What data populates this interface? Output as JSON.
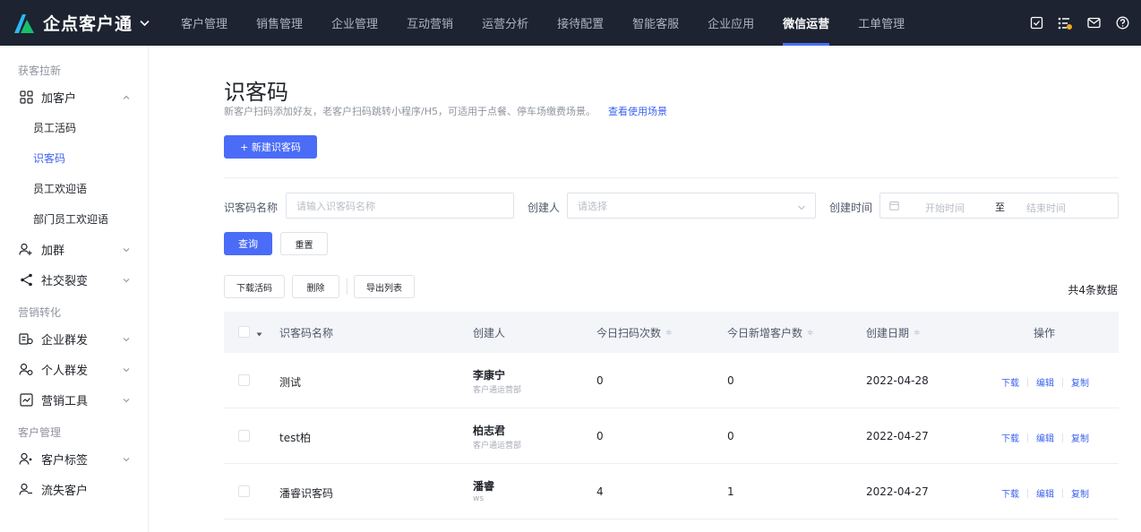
{
  "app": {
    "brand": "企点客户通"
  },
  "nav": {
    "items": [
      "客户管理",
      "销售管理",
      "企业管理",
      "互动营销",
      "运营分析",
      "接待配置",
      "智能客服",
      "企业应用",
      "微信运营",
      "工单管理"
    ],
    "active_index": 8
  },
  "sidebar": {
    "group1": "获客拉新",
    "add_customer": "加客户",
    "sub_items": [
      "员工活码",
      "识客码",
      "员工欢迎语",
      "部门员工欢迎语"
    ],
    "active_sub": "识客码",
    "add_group": "加群",
    "social_fission": "社交裂变",
    "group2": "营销转化",
    "enterprise_mass": "企业群发",
    "personal_mass": "个人群发",
    "marketing_tools": "营销工具",
    "group3": "客户管理",
    "customer_tags": "客户标签",
    "lost_customers": "流失客户"
  },
  "page": {
    "title": "识客码",
    "description": "新客户扫码添加好友，老客户扫码跳转小程序/H5，可适用于点餐、停车场缴费场景。",
    "scene_link": "查看使用场景",
    "new_button": "+ 新建识客码"
  },
  "filters": {
    "name_label": "识客码名称",
    "name_placeholder": "请输入识客码名称",
    "creator_label": "创建人",
    "creator_placeholder": "请选择",
    "time_label": "创建时间",
    "start_placeholder": "开始时间",
    "to": "至",
    "end_placeholder": "结束时间",
    "query": "查询",
    "reset": "重置"
  },
  "actions": {
    "download": "下载活码",
    "delete": "删除",
    "export": "导出列表",
    "total": "共4条数据"
  },
  "table": {
    "headers": [
      "识客码名称",
      "创建人",
      "今日扫码次数",
      "今日新增客户数",
      "创建日期",
      "操作"
    ],
    "sort_glyph": "≑",
    "rows": [
      {
        "name": "测试",
        "creator": "李康宁",
        "dept": "客户通运营部",
        "scans": "0",
        "new_customers": "0",
        "date": "2022-04-28"
      },
      {
        "name": "test柏",
        "creator": "柏志君",
        "dept": "客户通运营部",
        "scans": "0",
        "new_customers": "0",
        "date": "2022-04-27"
      },
      {
        "name": "潘睿识客码",
        "creator": "潘睿",
        "dept": "ws",
        "scans": "4",
        "new_customers": "1",
        "date": "2022-04-27"
      }
    ],
    "op_labels": [
      "下载",
      "编辑",
      "复制"
    ]
  },
  "colors": {
    "topbar": "#1d2330",
    "primary": "#4a6cf7",
    "link": "#3c63f0"
  }
}
